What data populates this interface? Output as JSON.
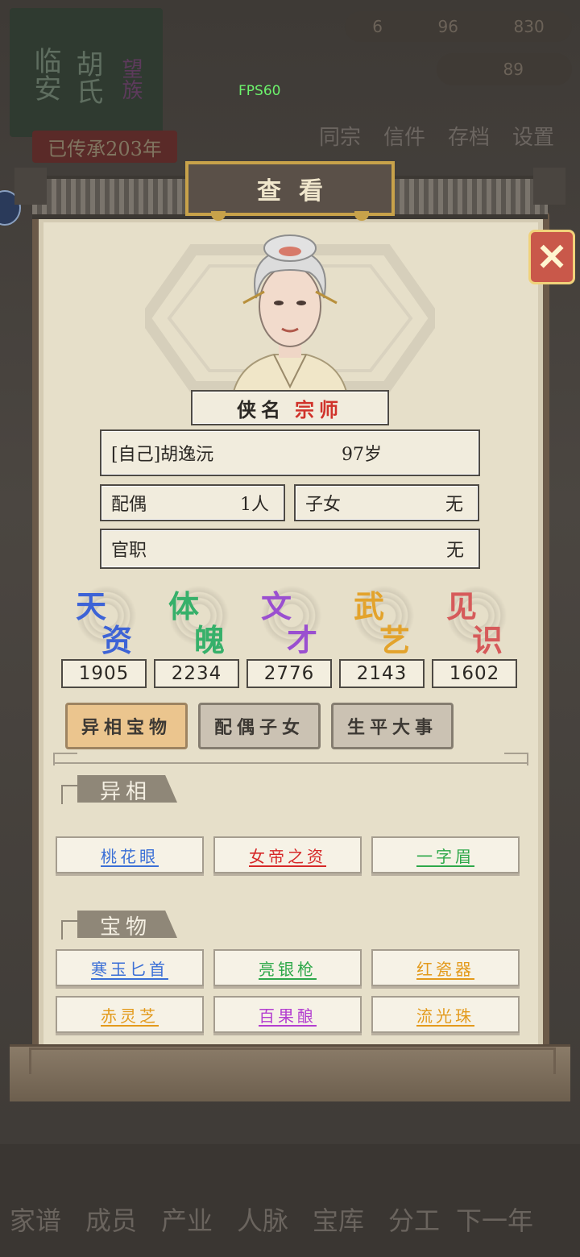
{
  "fps": "FPS60",
  "background": {
    "banner_chars": [
      "临安",
      "胡氏",
      "望族"
    ],
    "inherit_text": "已传承203年",
    "resources": [
      "6",
      "96",
      "830"
    ],
    "gold": "89",
    "top_menu": [
      "同宗",
      "信件",
      "存档",
      "设置"
    ],
    "bottom_nav": [
      "家谱",
      "成员",
      "产业",
      "人脉",
      "宝库",
      "分工",
      "下一年"
    ]
  },
  "dialog": {
    "title": "查看",
    "close_icon": "close-x-icon",
    "title_tag": {
      "prefix": "侠名",
      "value": "宗师"
    },
    "identity": {
      "name": "[自己]胡逸沅",
      "age": "97岁"
    },
    "spouse": {
      "label": "配偶",
      "value": "1人"
    },
    "children": {
      "label": "子女",
      "value": "无"
    },
    "office": {
      "label": "官职",
      "value": "无"
    },
    "stats": [
      {
        "c1": "天",
        "c2": "资",
        "value": "1905",
        "color": "#3d63d6"
      },
      {
        "c1": "体",
        "c2": "魄",
        "value": "2234",
        "color": "#36b06a"
      },
      {
        "c1": "文",
        "c2": "才",
        "value": "2776",
        "color": "#9a4fd0"
      },
      {
        "c1": "武",
        "c2": "艺",
        "value": "2143",
        "color": "#e3a32c"
      },
      {
        "c1": "见",
        "c2": "识",
        "value": "1602",
        "color": "#d65a5a"
      }
    ],
    "tabs": [
      "异相宝物",
      "配偶子女",
      "生平大事"
    ],
    "section_traits": "异相",
    "traits": [
      {
        "label": "桃花眼",
        "color": "#3b6fd6"
      },
      {
        "label": "女帝之资",
        "color": "#d62828"
      },
      {
        "label": "一字眉",
        "color": "#2ea84a"
      }
    ],
    "section_treasures": "宝物",
    "treasures": [
      {
        "label": "寒玉匕首",
        "color": "#3b6fd6"
      },
      {
        "label": "亮银枪",
        "color": "#2ea84a"
      },
      {
        "label": "红瓷器",
        "color": "#e39a1c"
      },
      {
        "label": "赤灵芝",
        "color": "#e39a1c"
      },
      {
        "label": "百果酿",
        "color": "#b33ed0"
      },
      {
        "label": "流光珠",
        "color": "#e39a1c"
      }
    ]
  }
}
